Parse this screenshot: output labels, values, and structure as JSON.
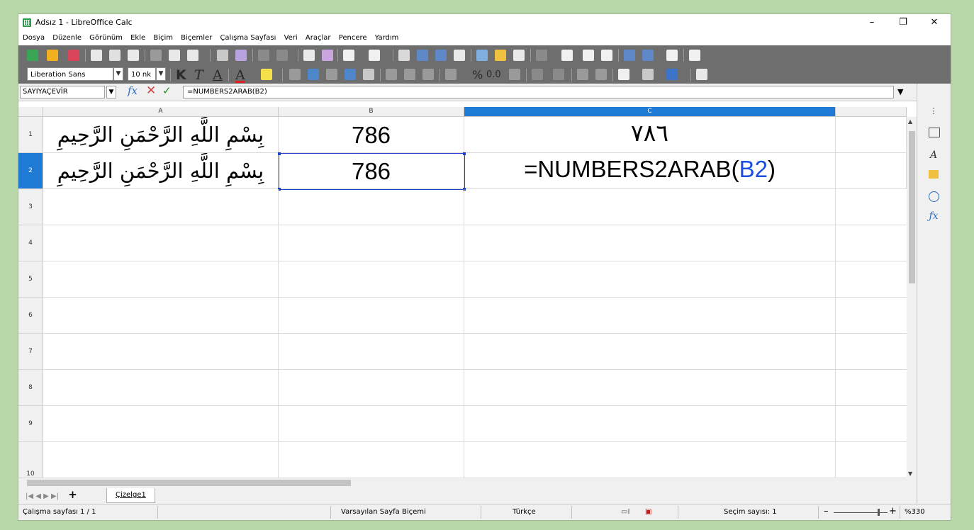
{
  "window": {
    "title": "Adsız 1 - LibreOffice Calc",
    "minimize_glyph": "–",
    "restore_glyph": "❐",
    "close_glyph": "✕"
  },
  "menu": [
    "Dosya",
    "Düzenle",
    "Görünüm",
    "Ekle",
    "Biçim",
    "Biçemler",
    "Çalışma Sayfası",
    "Veri",
    "Araçlar",
    "Pencere",
    "Yardım"
  ],
  "formatting": {
    "font_name": "Liberation Sans",
    "font_size": "10 nk",
    "bold_glyph": "K",
    "italic_glyph": "T",
    "underline_glyph": "A",
    "percent_glyph": "%",
    "decimal_glyph": "0.0"
  },
  "formula_bar": {
    "name_box": "SAYIYAÇEVİR",
    "fx_glyph": "fx",
    "cancel_glyph": "✕",
    "accept_glyph": "✓",
    "content": "=NUMBERS2ARAB(B2)",
    "expand_glyph": "▼"
  },
  "columns": [
    "A",
    "B",
    "C"
  ],
  "selected_column": "C",
  "rows": [
    "1",
    "2",
    "3",
    "4",
    "5",
    "6",
    "7",
    "8",
    "9",
    "10"
  ],
  "selected_row": "2",
  "cells": {
    "A1": "بِسْمِ اللَّهِ الرَّحْمَنِ الرَّحِيمِ",
    "B1": "786",
    "C1": "٧٨٦",
    "A2": "بِسْمِ اللَّهِ الرَّحْمَنِ الرَّحِيمِ",
    "B2": "786",
    "C2_prefix": "=NUMBERS2ARAB(",
    "C2_ref": "B2",
    "C2_suffix": ")"
  },
  "colors": {
    "accent": "#1f7ad6",
    "ref_highlight": "#1c4ee0",
    "background": "#b7d7a8",
    "toolbar": "#6e6e6e"
  },
  "sheet_tabs": {
    "add_glyph": "+",
    "active": "Çizelge1"
  },
  "status": {
    "sheet": "Çalışma sayfası 1 / 1",
    "page_style": "Varsayılan Sayfa Biçemi",
    "language": "Türkçe",
    "selection": "Seçim sayısı: 1",
    "zoom": "%330",
    "zoom_minus": "–",
    "zoom_plus": "+"
  },
  "icons": {
    "sidebar": [
      "properties-icon",
      "styles-icon",
      "gallery-icon",
      "navigator-icon",
      "functions-icon"
    ]
  }
}
